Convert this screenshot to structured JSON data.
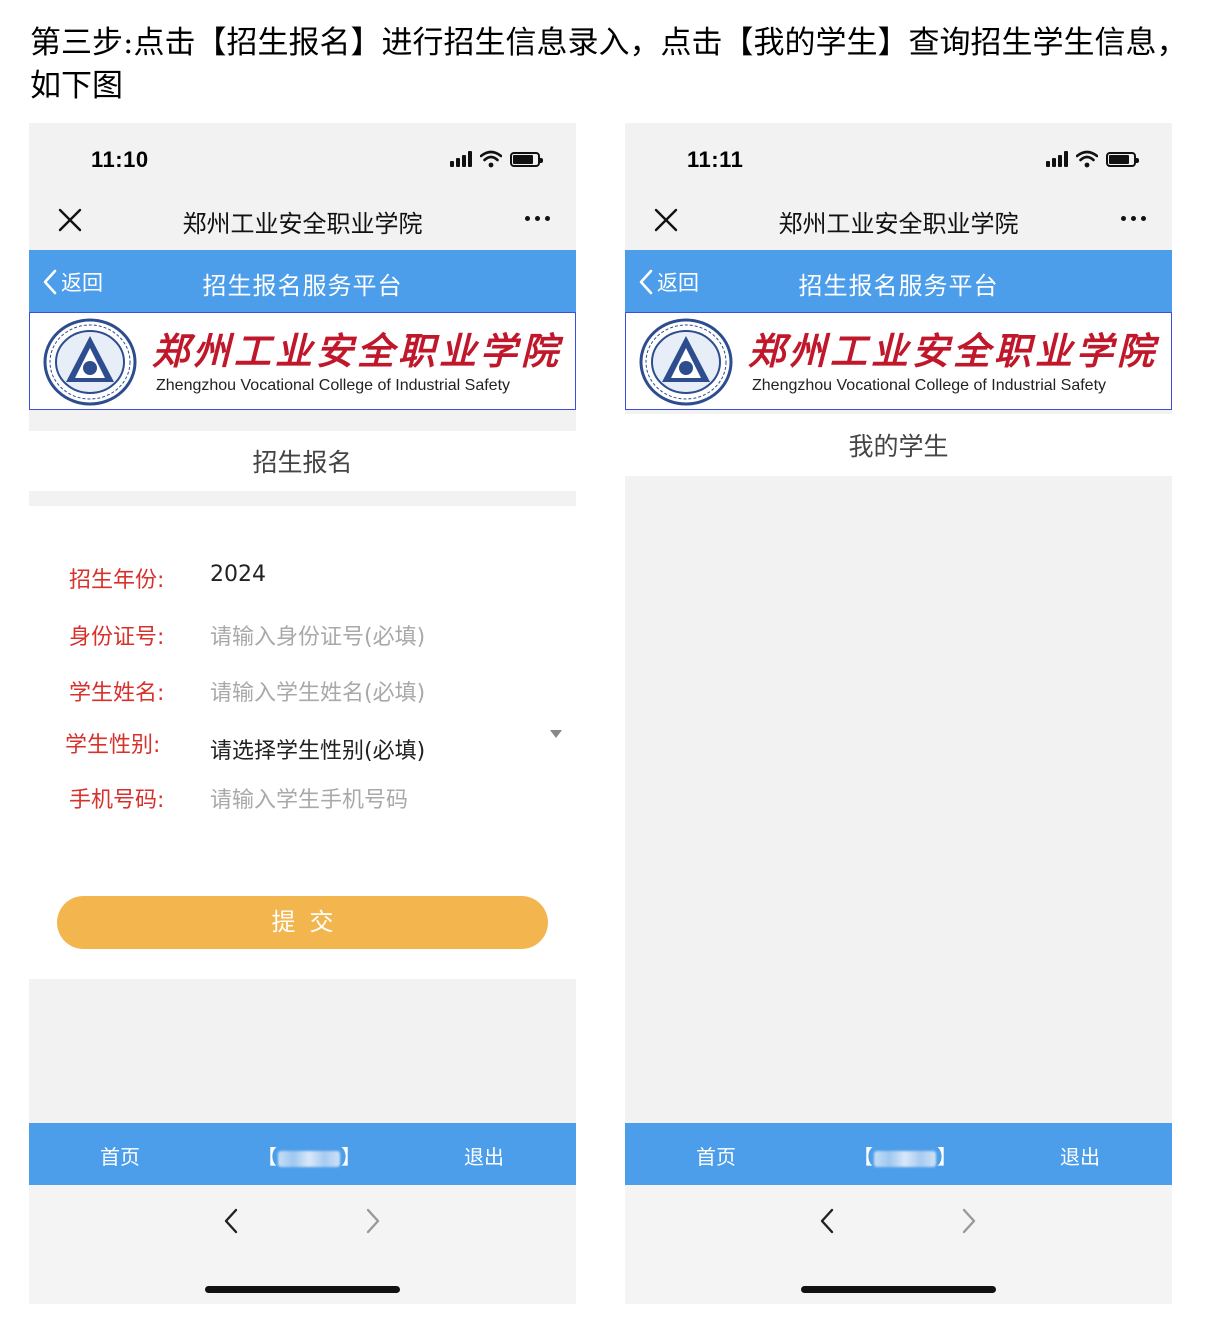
{
  "instruction": "第三步:点击【招生报名】进行招生信息录入，点击【我的学生】查询招生学生信息，如下图",
  "left": {
    "status_time": "11:10",
    "app_title": "郑州工业安全职业学院",
    "back_label": "返回",
    "platform_title": "招生报名服务平台",
    "school_name_cn": "郑州工业安全职业学院",
    "school_name_en": "Zhengzhou Vocational College of Industrial Safety",
    "section_title": "招生报名",
    "form": {
      "year_label": "招生年份:",
      "year_value": "2024",
      "id_label": "身份证号:",
      "id_placeholder": "请输入身份证号(必填)",
      "name_label": "学生姓名:",
      "name_placeholder": "请输入学生姓名(必填)",
      "gender_label": "学生性别:",
      "gender_value": "请选择学生性别(必填)",
      "phone_label": "手机号码:",
      "phone_placeholder": "请输入学生手机号码"
    },
    "submit_label": "提交",
    "tabbar": {
      "home": "首页",
      "bracket_left": "【",
      "bracket_right": "】",
      "logout": "退出"
    }
  },
  "right": {
    "status_time": "11:11",
    "app_title": "郑州工业安全职业学院",
    "back_label": "返回",
    "platform_title": "招生报名服务平台",
    "school_name_cn": "郑州工业安全职业学院",
    "school_name_en": "Zhengzhou Vocational College of Industrial Safety",
    "section_title": "我的学生",
    "tabbar": {
      "home": "首页",
      "bracket_left": "【",
      "bracket_right": "】",
      "logout": "退出"
    }
  },
  "colors": {
    "header_blue": "#4c9eea",
    "label_red": "#d8312c",
    "submit_orange": "#f3b64f",
    "school_red": "#c0172b"
  },
  "icons": [
    "close-icon",
    "more-icon",
    "chevron-left-icon",
    "signal-icon",
    "wifi-icon",
    "battery-icon",
    "caret-down-icon",
    "chevron-right-icon",
    "school-emblem"
  ]
}
